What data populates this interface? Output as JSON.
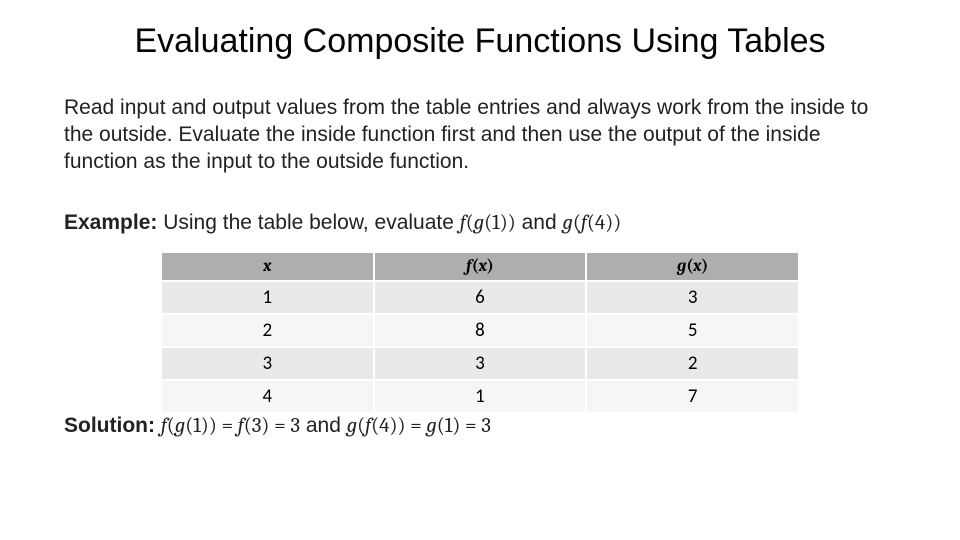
{
  "title": "Evaluating Composite Functions Using Tables",
  "body_text": "Read input and output values from the table entries and always work from the inside to the outside. Evaluate the inside function first and then use the output of the inside function as the input to the outside function.",
  "example": {
    "label": "Example:",
    "lead": " Using the table below, evaluate ",
    "expr1_f": "f",
    "expr1_open": "(",
    "expr1_g": "g",
    "expr1_inner": "(1)",
    "expr1_close": ")",
    "joiner": " and ",
    "expr2_g": "g",
    "expr2_open": "(",
    "expr2_f": "f",
    "expr2_inner": "(4)",
    "expr2_close": ")"
  },
  "table": {
    "headers": {
      "c0_var": "x",
      "c1_f": "f",
      "c1_paren_open": "(",
      "c1_var": "x",
      "c1_paren_close": ")",
      "c2_g": "g",
      "c2_paren_open": "(",
      "c2_var": "x",
      "c2_paren_close": ")"
    },
    "rows": [
      {
        "x": "1",
        "fx": "6",
        "gx": "3"
      },
      {
        "x": "2",
        "fx": "8",
        "gx": "5"
      },
      {
        "x": "3",
        "fx": "3",
        "gx": "2"
      },
      {
        "x": "4",
        "fx": "1",
        "gx": "7"
      }
    ]
  },
  "solution": {
    "label": "Solution:",
    "sp": "  ",
    "s1_f": "f",
    "s1_open": "(",
    "s1_g": "g",
    "s1_inner": "(1)",
    "s1_close": ")",
    "s1_eq1": " = ",
    "s1_f2": "f",
    "s1_f2arg": "(3)",
    "s1_eq2": " = 3",
    "joiner": " and ",
    "s2_g": "g",
    "s2_open": "(",
    "s2_f": "f",
    "s2_inner": "(4)",
    "s2_close": ")",
    "s2_eq1": " = ",
    "s2_g2": "g",
    "s2_g2arg": "(1)",
    "s2_eq2": " = 3"
  },
  "chart_data": {
    "type": "table",
    "title": "Evaluating Composite Functions Using Tables",
    "columns": [
      "x",
      "f(x)",
      "g(x)"
    ],
    "rows": [
      [
        1,
        6,
        3
      ],
      [
        2,
        8,
        5
      ],
      [
        3,
        3,
        2
      ],
      [
        4,
        1,
        7
      ]
    ],
    "example_expressions": [
      "f(g(1))",
      "g(f(4))"
    ],
    "solutions": {
      "f(g(1))": {
        "steps": [
          "f(3)",
          "3"
        ],
        "value": 3
      },
      "g(f(4))": {
        "steps": [
          "g(1)",
          "3"
        ],
        "value": 3
      }
    }
  }
}
